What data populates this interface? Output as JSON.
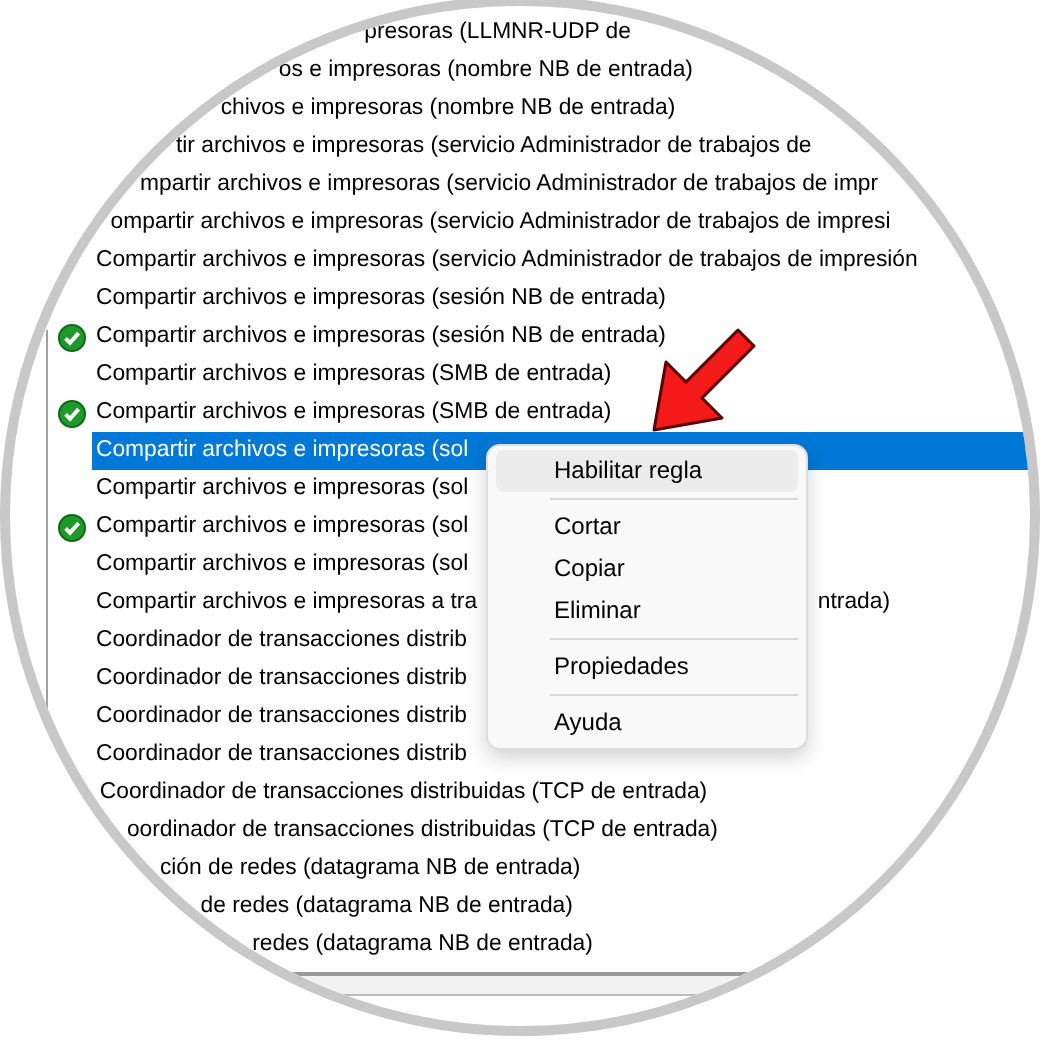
{
  "rules": [
    {
      "text": "presoras (LLMNR-UDP de",
      "enabled": false,
      "selected": false
    },
    {
      "text": "os e impresoras (nombre NB de entrada)",
      "enabled": false,
      "selected": false
    },
    {
      "text": "chivos e impresoras (nombre NB de entrada)",
      "enabled": false,
      "selected": false
    },
    {
      "text": "tir archivos e impresoras (servicio Administrador de trabajos de",
      "enabled": false,
      "selected": false
    },
    {
      "text": "mpartir archivos e impresoras (servicio Administrador de trabajos de impr",
      "enabled": false,
      "selected": false
    },
    {
      "text": "ompartir archivos e impresoras (servicio Administrador de trabajos de impresi",
      "enabled": false,
      "selected": false
    },
    {
      "text": "Compartir archivos e impresoras (servicio Administrador de trabajos de impresión",
      "enabled": false,
      "selected": false
    },
    {
      "text": "Compartir archivos e impresoras (sesión NB de entrada)",
      "enabled": false,
      "selected": false
    },
    {
      "text": "Compartir archivos e impresoras (sesión NB de entrada)",
      "enabled": true,
      "selected": false
    },
    {
      "text": "Compartir archivos e impresoras (SMB de entrada)",
      "enabled": false,
      "selected": false
    },
    {
      "text": "Compartir archivos e impresoras (SMB de entrada)",
      "enabled": true,
      "selected": false
    },
    {
      "text": "Compartir archivos e impresoras (sol",
      "enabled": false,
      "selected": true
    },
    {
      "text": "Compartir archivos e impresoras (sol",
      "enabled": false,
      "selected": false
    },
    {
      "text": "Compartir archivos e impresoras (sol",
      "enabled": true,
      "selected": false
    },
    {
      "text": "Compartir archivos e impresoras (sol",
      "enabled": false,
      "selected": false
    },
    {
      "text": "Compartir archivos e impresoras a tra",
      "tail": "ntrada)",
      "enabled": false,
      "selected": false
    },
    {
      "text": "Coordinador de transacciones distrib",
      "enabled": false,
      "selected": false
    },
    {
      "text": "Coordinador de transacciones distrib",
      "enabled": false,
      "selected": false
    },
    {
      "text": "Coordinador de transacciones distrib",
      "enabled": false,
      "selected": false
    },
    {
      "text": "Coordinador de transacciones distrib",
      "enabled": false,
      "selected": false
    },
    {
      "text": "Coordinador de transacciones distribuidas (TCP de entrada)",
      "enabled": false,
      "selected": false
    },
    {
      "text": "oordinador de transacciones distribuidas (TCP de entrada)",
      "enabled": false,
      "selected": false
    },
    {
      "text": "ción de redes (datagrama NB de entrada)",
      "enabled": false,
      "selected": false
    },
    {
      "text": "de redes (datagrama NB de entrada)",
      "enabled": false,
      "selected": false
    },
    {
      "text": "redes (datagrama NB de entrada)",
      "enabled": false,
      "selected": false
    }
  ],
  "context_menu": {
    "groups": [
      [
        {
          "label": "Habilitar regla",
          "highlighted": true
        }
      ],
      [
        {
          "label": "Cortar",
          "highlighted": false
        },
        {
          "label": "Copiar",
          "highlighted": false
        },
        {
          "label": "Eliminar",
          "highlighted": false
        }
      ],
      [
        {
          "label": "Propiedades",
          "highlighted": false
        }
      ],
      [
        {
          "label": "Ayuda",
          "highlighted": false
        }
      ]
    ]
  }
}
